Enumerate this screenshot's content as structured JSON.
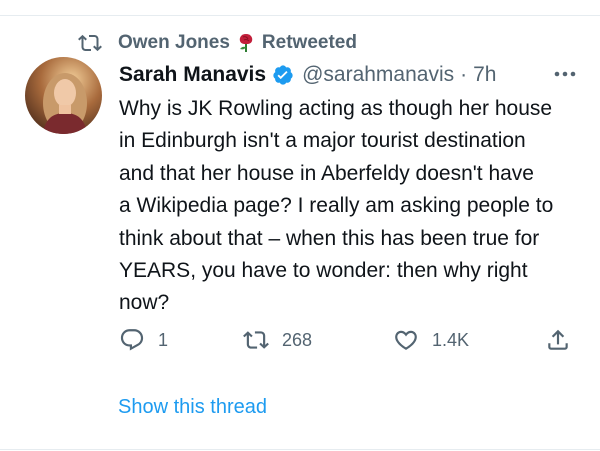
{
  "retweet": {
    "user": "Owen Jones",
    "label": "Retweeted"
  },
  "tweet": {
    "author_name": "Sarah Manavis",
    "handle": "@sarahmanavis",
    "separator": "·",
    "time": "7h",
    "text": "Why is JK Rowling acting as though her house\nin Edinburgh isn't a major tourist destination\nand that her house in Aberfeldy doesn't have\na Wikipedia page? I really am asking people to\nthink about that – when this has been true for\nYEARS, you have to wonder: then why right\nnow?"
  },
  "actions": {
    "replies": "1",
    "retweets": "268",
    "likes": "1.4K"
  },
  "show_thread_label": "Show this thread",
  "icons": {
    "retweet": "retweet-icon",
    "rose": "rose-icon",
    "verified": "verified-badge-icon",
    "more": "more-icon",
    "reply": "reply-icon",
    "like": "heart-icon",
    "share": "share-icon"
  },
  "colors": {
    "accent": "#1d9bf0",
    "muted": "#536471",
    "text": "#0f1419",
    "rose": "#c21e3a"
  }
}
